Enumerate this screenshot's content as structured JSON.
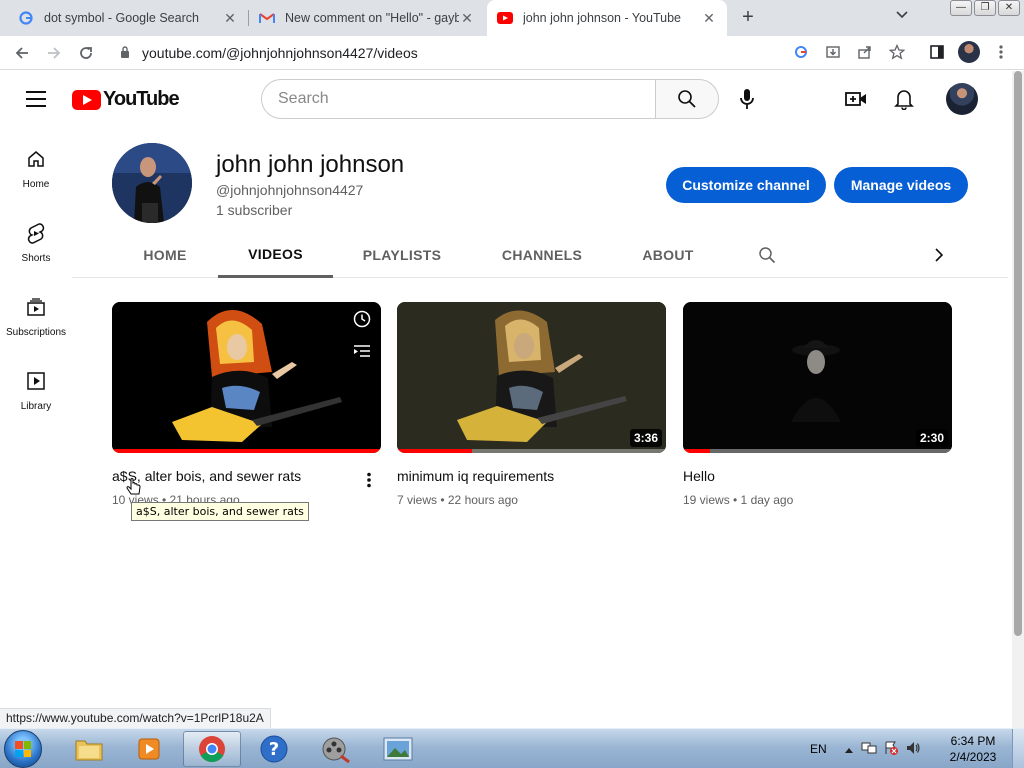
{
  "browser": {
    "tabs": [
      {
        "title": "dot symbol - Google Search",
        "favicon": "google-icon",
        "active": false
      },
      {
        "title": "New comment on \"Hello\" - gayb",
        "favicon": "gmail-icon",
        "active": false
      },
      {
        "title": "john john johnson - YouTube",
        "favicon": "youtube-icon",
        "active": true
      }
    ],
    "new_tab": "+",
    "url": "youtube.com/@johnjohnjohnson4427/videos",
    "status_url": "https://www.youtube.com/watch?v=1PcrlP18u2A"
  },
  "masthead": {
    "logo_text": "YouTube",
    "search_placeholder": "Search"
  },
  "guide": {
    "items": [
      {
        "label": "Home",
        "icon": "home-icon"
      },
      {
        "label": "Shorts",
        "icon": "shorts-icon"
      },
      {
        "label": "Subscriptions",
        "icon": "subscriptions-icon"
      },
      {
        "label": "Library",
        "icon": "library-icon"
      }
    ]
  },
  "channel": {
    "name": "john john johnson",
    "handle": "@johnjohnjohnson4427",
    "subscribers": "1 subscriber",
    "customize_label": "Customize channel",
    "manage_label": "Manage videos"
  },
  "tabs": [
    {
      "label": "HOME",
      "selected": false
    },
    {
      "label": "VIDEOS",
      "selected": true
    },
    {
      "label": "PLAYLISTS",
      "selected": false
    },
    {
      "label": "CHANNELS",
      "selected": false
    },
    {
      "label": "ABOUT",
      "selected": false
    }
  ],
  "videos": [
    {
      "title": "a$S, alter bois, and sewer rats",
      "meta": "10 views • 21 hours ago",
      "duration": "",
      "watched_fraction": 1.0
    },
    {
      "title": "minimum iq requirements",
      "meta": "7 views • 22 hours ago",
      "duration": "3:36",
      "watched_fraction": 0.28
    },
    {
      "title": "Hello",
      "meta": "19 views • 1 day ago",
      "duration": "2:30",
      "watched_fraction": 0.1
    }
  ],
  "tooltip": "a$S, alter bois, and sewer rats",
  "taskbar": {
    "language": "EN",
    "time": "6:34 PM",
    "date": "2/4/2023"
  },
  "colors": {
    "accent_blue": "#065fd4",
    "youtube_red": "#ff0000"
  }
}
